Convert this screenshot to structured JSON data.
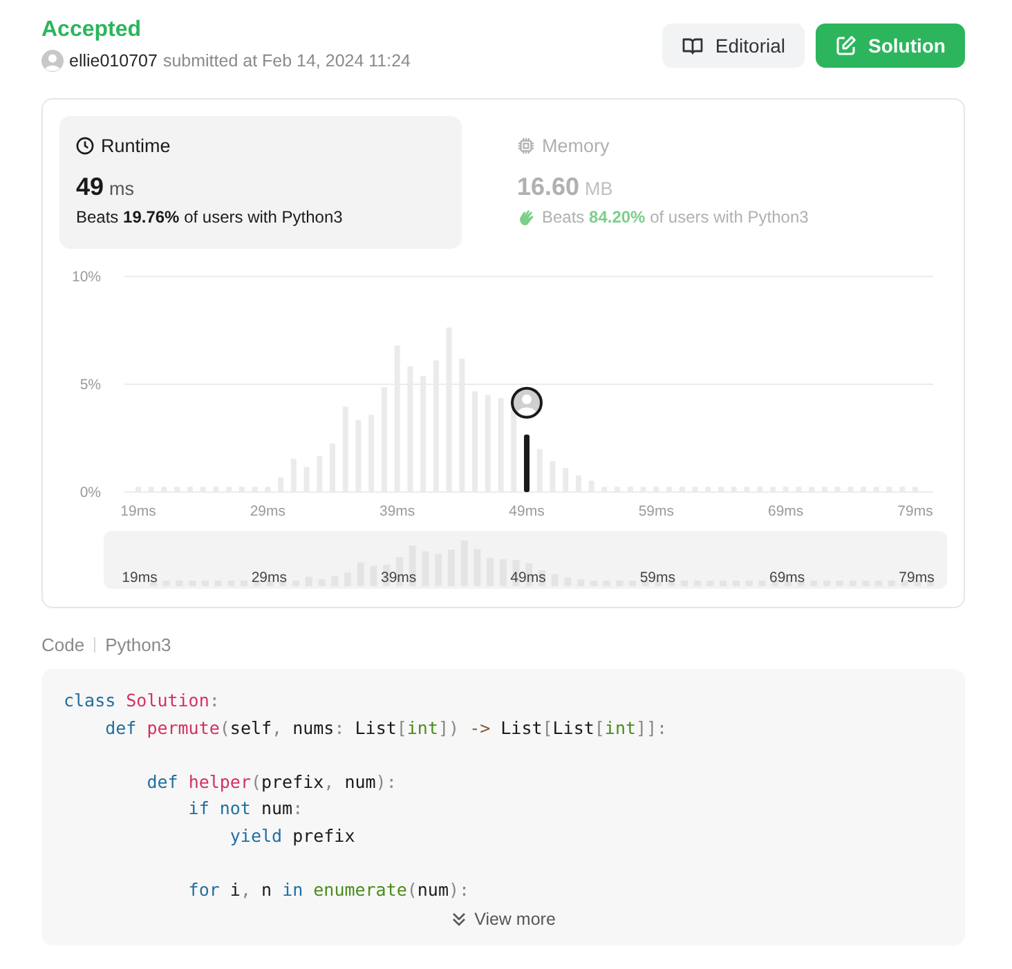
{
  "status": "Accepted",
  "author": {
    "username": "ellie010707",
    "submitted_text": "submitted at Feb 14, 2024 11:24"
  },
  "buttons": [
    {
      "label": "Editorial",
      "kind": "secondary"
    },
    {
      "label": "Solution",
      "kind": "primary"
    }
  ],
  "stats": [
    {
      "kind": "runtime",
      "label": "Runtime",
      "selected": true,
      "value": "49",
      "unit": "ms",
      "beats_prefix": "Beats",
      "beats_value": "19.76%",
      "beats_suffix": "of users with Python3"
    },
    {
      "kind": "memory",
      "label": "Memory",
      "selected": false,
      "value": "16.60",
      "unit": "MB",
      "beats_prefix": "Beats",
      "beats_value": "84.20%",
      "beats_suffix": "of users with Python3"
    }
  ],
  "chart_data": {
    "type": "bar",
    "x": [
      19,
      20,
      21,
      22,
      23,
      24,
      25,
      26,
      27,
      28,
      29,
      30,
      31,
      32,
      33,
      34,
      35,
      36,
      37,
      38,
      39,
      40,
      41,
      42,
      43,
      44,
      45,
      46,
      47,
      48,
      49,
      50,
      51,
      52,
      53,
      54,
      55,
      56,
      57,
      58,
      59,
      60,
      61,
      62,
      63,
      64,
      65,
      66,
      67,
      68,
      69,
      70,
      71,
      72,
      73,
      74,
      75,
      76,
      77,
      78,
      79
    ],
    "series": [
      {
        "color": "#ebebeb",
        "values": [
          0.25,
          0.25,
          0.25,
          0.25,
          0.25,
          0.25,
          0.25,
          0.25,
          0.25,
          0.25,
          0.25,
          0.67,
          1.55,
          1.17,
          1.67,
          2.25,
          3.97,
          3.33,
          3.58,
          4.86,
          6.8,
          5.83,
          5.39,
          6.11,
          7.64,
          6.19,
          4.67,
          4.5,
          4.36,
          3.83,
          null,
          2.0,
          1.44,
          1.11,
          0.78,
          0.53,
          0.25,
          0.25,
          0.25,
          0.25,
          0.25,
          0.25,
          0.25,
          0.25,
          0.25,
          0.25,
          0.25,
          0.25,
          0.25,
          0.25,
          0.25,
          0.25,
          0.25,
          0.25,
          0.25,
          0.25,
          0.25,
          0.25,
          0.25,
          0.25,
          0.25
        ]
      },
      {
        "color": "#1a1a1a",
        "values": [
          null,
          null,
          null,
          null,
          null,
          null,
          null,
          null,
          null,
          null,
          null,
          null,
          null,
          null,
          null,
          null,
          null,
          null,
          null,
          null,
          null,
          null,
          null,
          null,
          null,
          null,
          null,
          null,
          null,
          null,
          2.67,
          null,
          null,
          null,
          null,
          null,
          null,
          null,
          null,
          null,
          null,
          null,
          null,
          null,
          null,
          null,
          null,
          null,
          null,
          null,
          null,
          null,
          null,
          null,
          null,
          null,
          null,
          null,
          null,
          null,
          null
        ]
      }
    ],
    "xlim": [
      19,
      79
    ],
    "ylim": [
      0,
      10
    ],
    "yticks": [
      {
        "value": 0,
        "label": "0%"
      },
      {
        "value": 5,
        "label": "5%"
      },
      {
        "value": 10,
        "label": "10%"
      }
    ],
    "xticks": [
      {
        "value": 19,
        "label": "19ms"
      },
      {
        "value": 29,
        "label": "29ms"
      },
      {
        "value": 39,
        "label": "39ms"
      },
      {
        "value": 49,
        "label": "49ms"
      },
      {
        "value": 59,
        "label": "59ms"
      },
      {
        "value": 69,
        "label": "69ms"
      },
      {
        "value": 79,
        "label": "79ms"
      }
    ]
  },
  "navigator": {
    "tick_labels": [
      "19ms",
      "29ms",
      "39ms",
      "49ms",
      "59ms",
      "69ms",
      "79ms"
    ]
  },
  "code": {
    "label": "Code",
    "language": "Python3",
    "view_more": "View more",
    "lines": [
      {
        "kind": "code",
        "tokens": [
          {
            "text": "class ",
            "kind": "keyword"
          },
          {
            "text": "Solution",
            "kind": "name"
          },
          {
            "text": ":",
            "kind": "punct"
          }
        ],
        "children": [
          {
            "kind": "code",
            "tokens": [
              {
                "text": "def ",
                "kind": "keyword"
              },
              {
                "text": "permute",
                "kind": "name"
              },
              {
                "text": "(",
                "kind": "punct"
              },
              {
                "text": "self",
                "kind": "plain"
              },
              {
                "text": ", ",
                "kind": "punct"
              },
              {
                "text": "nums",
                "kind": "plain"
              },
              {
                "text": ": ",
                "kind": "punct"
              },
              {
                "text": "List",
                "kind": "plain"
              },
              {
                "text": "[",
                "kind": "punct"
              },
              {
                "text": "int",
                "kind": "type"
              },
              {
                "text": "]) ",
                "kind": "punct"
              },
              {
                "text": "-> ",
                "kind": "operator"
              },
              {
                "text": "List",
                "kind": "plain"
              },
              {
                "text": "[",
                "kind": "punct"
              },
              {
                "text": "List",
                "kind": "plain"
              },
              {
                "text": "[",
                "kind": "punct"
              },
              {
                "text": "int",
                "kind": "type"
              },
              {
                "text": "]]:",
                "kind": "punct"
              }
            ],
            "children": [
              {
                "kind": "blank"
              },
              {
                "kind": "code",
                "tokens": [
                  {
                    "text": "def ",
                    "kind": "keyword"
                  },
                  {
                    "text": "helper",
                    "kind": "name"
                  },
                  {
                    "text": "(",
                    "kind": "punct"
                  },
                  {
                    "text": "prefix",
                    "kind": "plain"
                  },
                  {
                    "text": ", ",
                    "kind": "punct"
                  },
                  {
                    "text": "num",
                    "kind": "plain"
                  },
                  {
                    "text": "):",
                    "kind": "punct"
                  }
                ],
                "children": [
                  {
                    "kind": "code",
                    "tokens": [
                      {
                        "text": "if not ",
                        "kind": "keyword"
                      },
                      {
                        "text": "num",
                        "kind": "plain"
                      },
                      {
                        "text": ":",
                        "kind": "punct"
                      }
                    ],
                    "children": [
                      {
                        "kind": "code",
                        "tokens": [
                          {
                            "text": "yield ",
                            "kind": "keyword"
                          },
                          {
                            "text": "prefix",
                            "kind": "plain"
                          }
                        ]
                      }
                    ]
                  },
                  {
                    "kind": "blank"
                  },
                  {
                    "kind": "code",
                    "tokens": [
                      {
                        "text": "for ",
                        "kind": "keyword"
                      },
                      {
                        "text": "i",
                        "kind": "plain"
                      },
                      {
                        "text": ", ",
                        "kind": "punct"
                      },
                      {
                        "text": "n ",
                        "kind": "plain"
                      },
                      {
                        "text": "in ",
                        "kind": "keyword"
                      },
                      {
                        "text": "enumerate",
                        "kind": "type"
                      },
                      {
                        "text": "(",
                        "kind": "punct"
                      },
                      {
                        "text": "num",
                        "kind": "plain"
                      },
                      {
                        "text": "):",
                        "kind": "punct"
                      }
                    ]
                  }
                ]
              }
            ]
          }
        ]
      }
    ]
  }
}
